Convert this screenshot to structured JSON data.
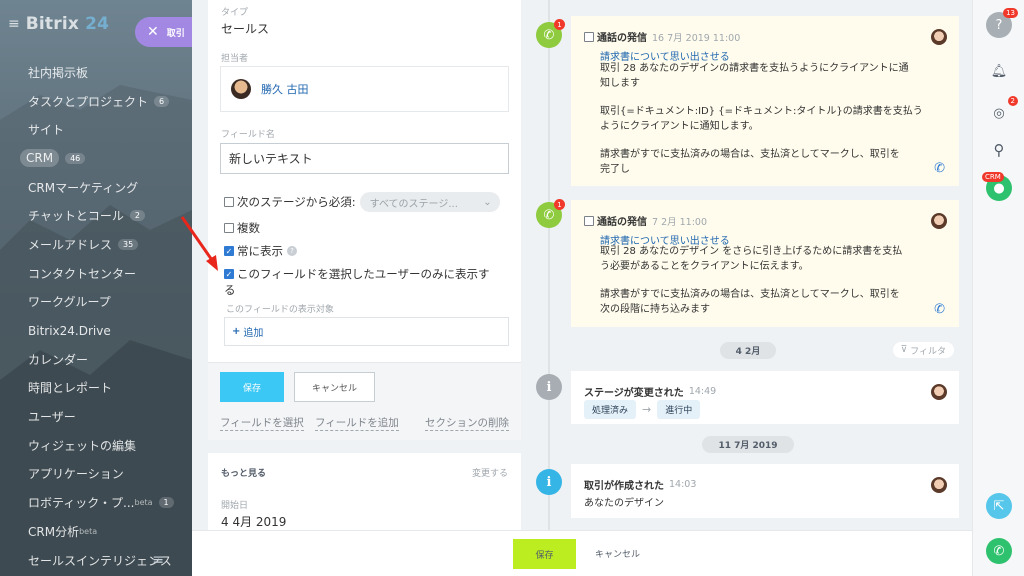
{
  "sidebar": {
    "logo_main": "Bitrix",
    "logo_num": "24",
    "items": [
      {
        "label": "社内掲示板",
        "count": ""
      },
      {
        "label": "タスクとプロジェクト",
        "count": "6"
      },
      {
        "label": "サイト",
        "count": ""
      },
      {
        "label": "CRM",
        "count": "46"
      },
      {
        "label": "CRMマーケティング",
        "count": ""
      },
      {
        "label": "チャットとコール",
        "count": "2"
      },
      {
        "label": "メールアドレス",
        "count": "35"
      },
      {
        "label": "コンタクトセンター",
        "count": ""
      },
      {
        "label": "ワークグループ",
        "count": ""
      },
      {
        "label": "Bitrix24.Drive",
        "count": ""
      },
      {
        "label": "カレンダー",
        "count": ""
      },
      {
        "label": "時間とレポート",
        "count": ""
      },
      {
        "label": "ユーザー",
        "count": ""
      },
      {
        "label": "ウィジェットの編集",
        "count": ""
      },
      {
        "label": "アプリケーション",
        "count": ""
      },
      {
        "label": "ロボティック・プ...",
        "beta": "beta",
        "count": "1"
      },
      {
        "label": "CRM分析",
        "beta": "beta",
        "count": ""
      },
      {
        "label": "セールスインテリジェンス",
        "count": ""
      }
    ]
  },
  "close_tab": {
    "label": "取引"
  },
  "form": {
    "type_label": "タイプ",
    "type_value": "セールス",
    "assignee_label": "担当者",
    "assignee_name": "勝久 古田",
    "field_name_label": "フィールド名",
    "field_name_value": "新しいテキスト",
    "required_label": "次のステージから必須:",
    "stage_select": "すべてのステージ...",
    "multiple_label": "複数",
    "always_show_label": "常に表示",
    "selected_users_line1": "このフィールドを選択したユーザーのみに表示す",
    "selected_users_line2": "る",
    "visible_to_label": "このフィールドの表示対象",
    "add_label": "追加",
    "save_button": "保存",
    "cancel_button": "キャンセル",
    "select_field_link": "フィールドを選択",
    "add_field_link": "フィールドを追加",
    "delete_section_link": "セクションの削除",
    "more_label": "もっと見る",
    "change_label": "変更する",
    "start_date_label": "開始日",
    "start_date_value": "4 4月 2019"
  },
  "timeline": {
    "call1": {
      "badge": "1",
      "title": "通話の発信",
      "time": "16 7月 2019 11:00",
      "link": "請求書について思い出させる",
      "line1": "取引 28 あなたのデザインの請求書を支払うようにクライアントに通",
      "line2": "知します",
      "line3": "取引{=ドキュメント:ID} {=ドキュメント:タイトル}の請求書を支払う",
      "line4": "ようにクライアントに通知します。",
      "line5": "請求書がすでに支払済みの場合は、支払済としてマークし、取引を",
      "line6": "完了し"
    },
    "call2": {
      "badge": "1",
      "title": "通話の発信",
      "time": "7 2月 11:00",
      "link": "請求書について思い出させる",
      "line1": "取引 28 あなたのデザイン をさらに引き上げるために請求書を支払",
      "line2": "う必要があることをクライアントに伝えます。",
      "line3": "請求書がすでに支払済みの場合は、支払済としてマークし、取引を",
      "line4": "次の段階に持ち込みます"
    },
    "date1": "4 2月",
    "filter": "フィルタ",
    "stage_change": {
      "title": "ステージが変更された",
      "time": "14:49",
      "from": "処理済み",
      "to": "進行中"
    },
    "date2": "11 7月 2019",
    "created": {
      "title": "取引が作成された",
      "time": "14:03",
      "body": "あなたのデザイン"
    }
  },
  "bottom": {
    "save": "保存",
    "cancel": "キャンセル"
  },
  "rightbar": {
    "help_badge": "13",
    "chat_badge": "2",
    "crm_tag": "CRM"
  }
}
